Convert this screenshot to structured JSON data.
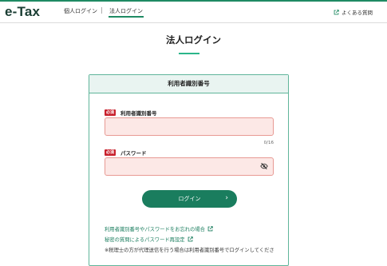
{
  "app": {
    "logo": "e-Tax"
  },
  "nav": {
    "tabs": [
      {
        "label": "個人ログイン",
        "active": false
      },
      {
        "label": "法人ログイン",
        "active": true
      }
    ],
    "separator": "|",
    "faq_label": "よくある質問"
  },
  "page": {
    "title": "法人ログイン"
  },
  "form": {
    "header": "利用者識別番号",
    "required_badge": "必須",
    "user_id": {
      "label": "利用者識別番号",
      "value": "",
      "counter": "0/16"
    },
    "password": {
      "label": "パスワード",
      "value": ""
    },
    "login_button": "ログイン",
    "links": {
      "forgot": "利用者識別番号やパスワードをお忘れの場合",
      "reset": "秘密の質問によるパスワード再設定"
    },
    "note": "※税理士の方が代理送信を行う場合は利用者識別番号でログインしてくださ"
  },
  "colors": {
    "brand_green": "#1a7d5e",
    "required_red": "#c8202c",
    "input_bg": "#fce8e6"
  },
  "icons": [
    "external-link-icon",
    "eye-slash-icon",
    "chevron-right-icon"
  ]
}
